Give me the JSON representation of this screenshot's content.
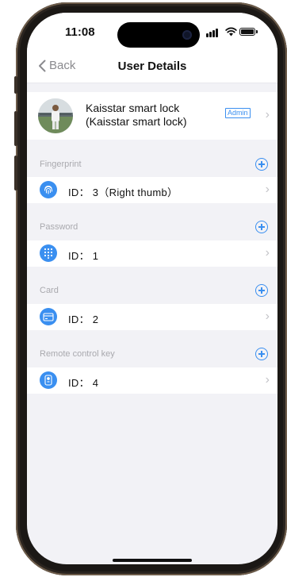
{
  "status_bar": {
    "time": "11:08"
  },
  "nav": {
    "back_label": "Back",
    "title": "User Details"
  },
  "user": {
    "name": "Kaisstar smart lock (Kaisstar smart lock)",
    "role_badge": "Admin"
  },
  "sections": [
    {
      "label": "Fingerprint",
      "icon": "fingerprint-icon",
      "item": "ID： 3（Right thumb）"
    },
    {
      "label": "Password",
      "icon": "keypad-icon",
      "item": "ID： 1"
    },
    {
      "label": "Card",
      "icon": "card-icon",
      "item": "ID： 2"
    },
    {
      "label": "Remote control key",
      "icon": "remote-key-icon",
      "item": "ID： 4"
    }
  ],
  "colors": {
    "accent": "#3a8ff0",
    "background": "#f2f2f6",
    "label": "#a9a9ae"
  }
}
